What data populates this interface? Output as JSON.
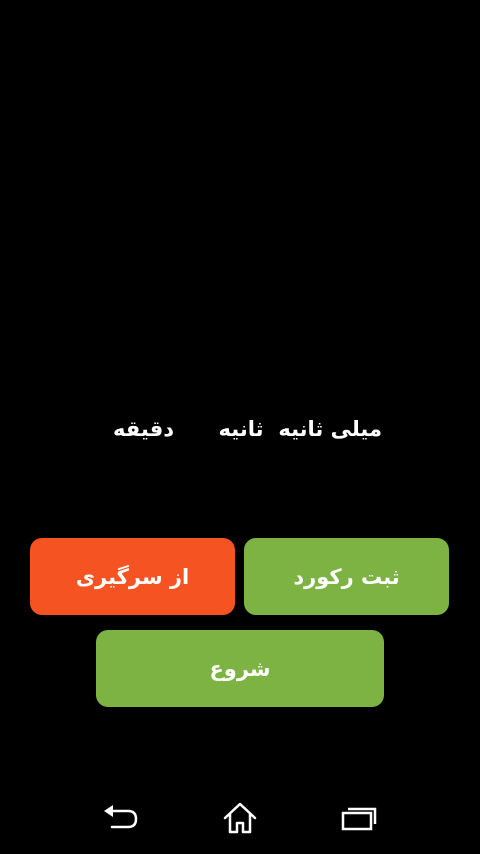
{
  "labels": {
    "milliseconds": "میلی ثانیه",
    "seconds": "ثانیه",
    "minutes": "دقیقه"
  },
  "buttons": {
    "reset": {
      "label": "از سرگیری",
      "color": "#f65322"
    },
    "record": {
      "label": "ثبت رکورد",
      "color": "#7db343"
    },
    "start": {
      "label": "شروع",
      "color": "#7db343"
    }
  },
  "navbar": {
    "back_icon": "back-arrow-icon",
    "home_icon": "home-icon",
    "recents_icon": "recent-apps-icon"
  }
}
